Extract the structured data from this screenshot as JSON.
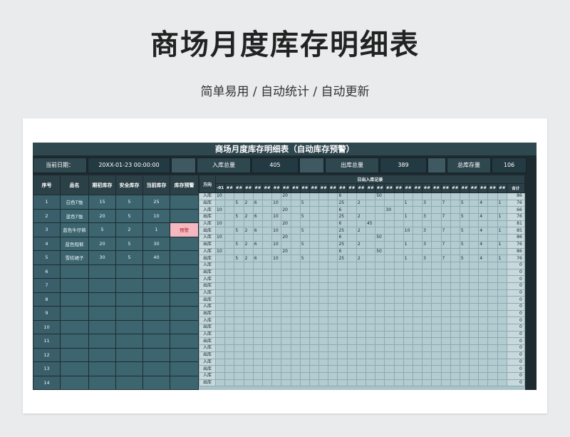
{
  "page": {
    "title": "商场月度库存明细表",
    "subtitle": "简单易用 / 自动统计 / 自动更新"
  },
  "sheet": {
    "title": "商场月度库存明细表（自动库存预警）",
    "info": {
      "date_label": "当前日期：",
      "date_value": "20XX-01-23 00:00:00",
      "in_label": "入库总量",
      "in_value": "405",
      "out_label": "出库总量",
      "out_value": "389",
      "stock_label": "总库存量",
      "stock_value": "106"
    },
    "left_headers": [
      "序号",
      "品名",
      "期初库存",
      "安全库存",
      "当前库存",
      "库存预警"
    ],
    "left_rows": [
      {
        "seq": "1",
        "name": "白色T恤",
        "initial": "15",
        "safe": "5",
        "current": "25",
        "warn": ""
      },
      {
        "seq": "2",
        "name": "蓝色T恤",
        "initial": "20",
        "safe": "5",
        "current": "10",
        "warn": ""
      },
      {
        "seq": "3",
        "name": "蓝色牛仔裤",
        "initial": "5",
        "safe": "2",
        "current": "1",
        "warn": "预警"
      },
      {
        "seq": "4",
        "name": "蓝色短裤",
        "initial": "20",
        "safe": "5",
        "current": "30",
        "warn": ""
      },
      {
        "seq": "5",
        "name": "雪纺裙子",
        "initial": "30",
        "safe": "5",
        "current": "40",
        "warn": ""
      },
      {
        "seq": "6",
        "name": "",
        "initial": "",
        "safe": "",
        "current": "",
        "warn": ""
      },
      {
        "seq": "7",
        "name": "",
        "initial": "",
        "safe": "",
        "current": "",
        "warn": ""
      },
      {
        "seq": "8",
        "name": "",
        "initial": "",
        "safe": "",
        "current": "",
        "warn": ""
      },
      {
        "seq": "9",
        "name": "",
        "initial": "",
        "safe": "",
        "current": "",
        "warn": ""
      },
      {
        "seq": "10",
        "name": "",
        "initial": "",
        "safe": "",
        "current": "",
        "warn": ""
      },
      {
        "seq": "11",
        "name": "",
        "initial": "",
        "safe": "",
        "current": "",
        "warn": ""
      },
      {
        "seq": "12",
        "name": "",
        "initial": "",
        "safe": "",
        "current": "",
        "warn": ""
      },
      {
        "seq": "13",
        "name": "",
        "initial": "",
        "safe": "",
        "current": "",
        "warn": ""
      },
      {
        "seq": "14",
        "name": "",
        "initial": "",
        "safe": "",
        "current": "",
        "warn": ""
      }
    ],
    "right": {
      "dir_header": "方向",
      "group_header": "日出入库记录",
      "date_headers": [
        "-01",
        "##",
        "##",
        "##",
        "##",
        "##",
        "##",
        "##",
        "##",
        "##",
        "##",
        "##",
        "##",
        "##",
        "##",
        "##",
        "##",
        "##",
        "##",
        "##",
        "##",
        "##",
        "##",
        "##",
        "##",
        "##",
        "##",
        "##",
        "##",
        "##",
        "##"
      ],
      "total_header": "合计",
      "in_label": "入库",
      "out_label": "出库",
      "rows": [
        {
          "dir": "入库",
          "vals": [
            "10",
            "",
            "",
            "",
            "",
            "",
            "",
            "20",
            "",
            "",
            "",
            "",
            "",
            "6",
            "",
            "",
            "",
            "50",
            "",
            "",
            "",
            "",
            "",
            "",
            "",
            "",
            "",
            "",
            "",
            "",
            ""
          ],
          "total": "86"
        },
        {
          "dir": "出库",
          "vals": [
            "",
            "",
            "5",
            "2",
            "6",
            "",
            "10",
            "",
            "",
            "5",
            "",
            "",
            "",
            "25",
            "",
            "2",
            "",
            "",
            "",
            "",
            "1",
            "",
            "3",
            "",
            "7",
            "",
            "5",
            "",
            "4",
            "",
            "1"
          ],
          "total": "76"
        },
        {
          "dir": "入库",
          "vals": [
            "10",
            "",
            "",
            "",
            "",
            "",
            "",
            "20",
            "",
            "",
            "",
            "",
            "",
            "6",
            "",
            "",
            "",
            "",
            "30",
            "",
            "",
            "",
            "",
            "",
            "",
            "",
            "",
            "",
            "",
            "",
            ""
          ],
          "total": "66"
        },
        {
          "dir": "出库",
          "vals": [
            "",
            "",
            "5",
            "2",
            "6",
            "",
            "10",
            "",
            "",
            "5",
            "",
            "",
            "",
            "25",
            "",
            "2",
            "",
            "",
            "",
            "",
            "1",
            "",
            "3",
            "",
            "7",
            "",
            "5",
            "",
            "4",
            "",
            "1"
          ],
          "total": "76"
        },
        {
          "dir": "入库",
          "vals": [
            "10",
            "",
            "",
            "",
            "",
            "",
            "",
            "20",
            "",
            "",
            "",
            "",
            "",
            "6",
            "",
            "",
            "45",
            "",
            "",
            "",
            "",
            "",
            "",
            "",
            "",
            "",
            "",
            "",
            "",
            "",
            ""
          ],
          "total": "81"
        },
        {
          "dir": "出库",
          "vals": [
            "",
            "",
            "5",
            "2",
            "6",
            "",
            "10",
            "",
            "",
            "5",
            "",
            "",
            "",
            "25",
            "",
            "2",
            "",
            "",
            "",
            "",
            "10",
            "",
            "3",
            "",
            "7",
            "",
            "5",
            "",
            "4",
            "",
            "1"
          ],
          "total": "85"
        },
        {
          "dir": "入库",
          "vals": [
            "10",
            "",
            "",
            "",
            "",
            "",
            "",
            "20",
            "",
            "",
            "",
            "",
            "",
            "6",
            "",
            "",
            "",
            "50",
            "",
            "",
            "",
            "",
            "",
            "",
            "",
            "",
            "",
            "",
            "",
            "",
            ""
          ],
          "total": "86"
        },
        {
          "dir": "出库",
          "vals": [
            "",
            "",
            "5",
            "2",
            "6",
            "",
            "10",
            "",
            "",
            "5",
            "",
            "",
            "",
            "25",
            "",
            "2",
            "",
            "",
            "",
            "",
            "1",
            "",
            "3",
            "",
            "7",
            "",
            "5",
            "",
            "4",
            "",
            "1"
          ],
          "total": "76"
        },
        {
          "dir": "入库",
          "vals": [
            "10",
            "",
            "",
            "",
            "",
            "",
            "",
            "20",
            "",
            "",
            "",
            "",
            "",
            "6",
            "",
            "",
            "",
            "50",
            "",
            "",
            "",
            "",
            "",
            "",
            "",
            "",
            "",
            "",
            "",
            "",
            ""
          ],
          "total": "86"
        },
        {
          "dir": "出库",
          "vals": [
            "",
            "",
            "5",
            "2",
            "6",
            "",
            "10",
            "",
            "",
            "5",
            "",
            "",
            "",
            "25",
            "",
            "2",
            "",
            "",
            "",
            "",
            "1",
            "",
            "3",
            "",
            "7",
            "",
            "5",
            "",
            "4",
            "",
            "1"
          ],
          "total": "76"
        }
      ],
      "empty_total": "0"
    }
  }
}
